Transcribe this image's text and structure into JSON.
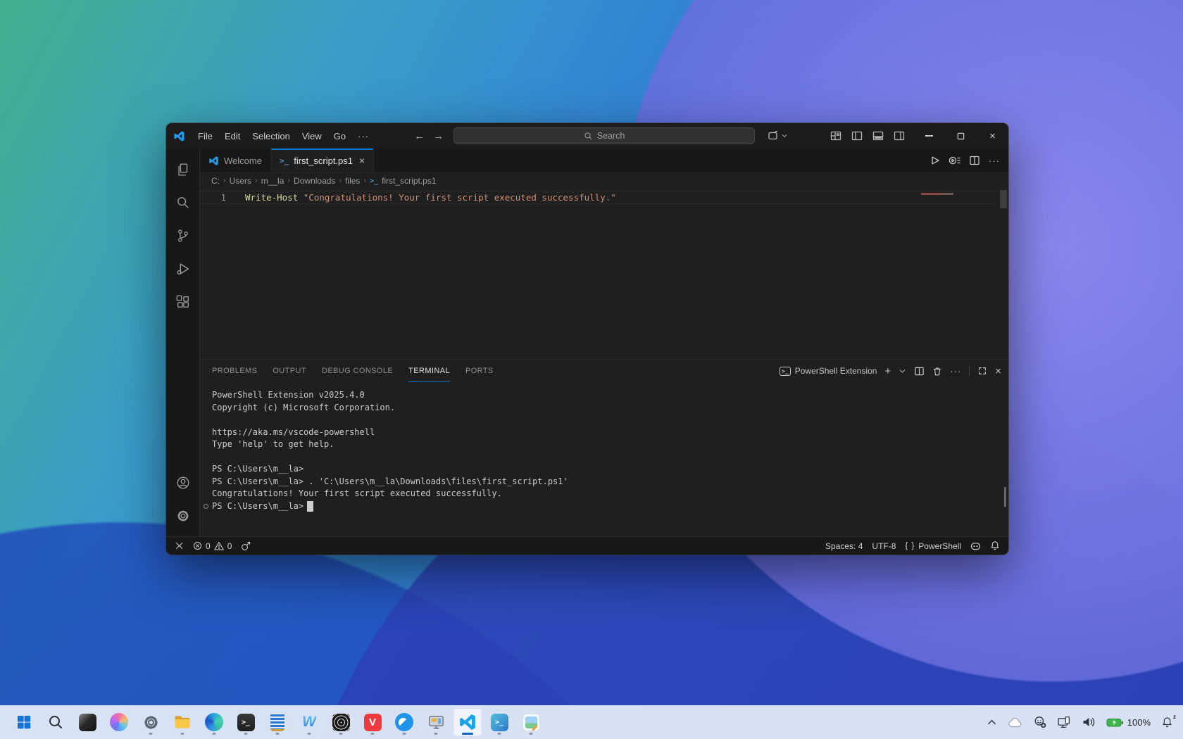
{
  "titlebar": {
    "menus": [
      "File",
      "Edit",
      "Selection",
      "View",
      "Go"
    ],
    "search_placeholder": "Search"
  },
  "glyphs": {
    "back": "←",
    "forward": "→",
    "ellipsis": "···",
    "close": "×",
    "plus": "+",
    "ps": ">_",
    "braces": "{ }"
  },
  "tabs": {
    "welcome": "Welcome",
    "script": "first_script.ps1"
  },
  "breadcrumb": {
    "items": [
      "C:",
      "Users",
      "m__la",
      "Downloads",
      "files"
    ],
    "separator": "›",
    "file": "first_script.ps1"
  },
  "editor": {
    "line_number": "1",
    "cmdlet": "Write-Host",
    "string": "\"Congratulations! Your first script executed successfully.\""
  },
  "panel": {
    "tabs": [
      "PROBLEMS",
      "OUTPUT",
      "DEBUG CONSOLE",
      "TERMINAL",
      "PORTS"
    ],
    "active_tab": "TERMINAL",
    "shell_label": "PowerShell Extension"
  },
  "terminal": {
    "lines": [
      "PowerShell Extension v2025.4.0",
      "Copyright (c) Microsoft Corporation.",
      "",
      "https://aka.ms/vscode-powershell",
      "Type 'help' to get help.",
      "",
      "PS C:\\Users\\m__la>",
      "PS C:\\Users\\m__la> . 'C:\\Users\\m__la\\Downloads\\files\\first_script.ps1'",
      "Congratulations! Your first script executed successfully."
    ],
    "prompt": "PS C:\\Users\\m__la>"
  },
  "statusbar": {
    "errors": "0",
    "warnings": "0",
    "spaces": "Spaces: 4",
    "encoding": "UTF-8",
    "language": "PowerShell"
  },
  "taskbar": {
    "apps": [
      "start",
      "search",
      "dark-app",
      "copilot",
      "settings",
      "file-explorer",
      "edge",
      "windows-terminal",
      "striped-app",
      "w-app",
      "rings-app",
      "vivaldi",
      "blue-browser",
      "pc-tools",
      "vscode",
      "powershell",
      "photos"
    ]
  },
  "tray": {
    "battery": "100%"
  },
  "colors": {
    "accent": "#0078d4",
    "cmdlet": "#dcdcaa",
    "string": "#ce9178",
    "terminal_text": "#cccccc",
    "editor_bg": "#1f1f1f",
    "chrome_bg": "#181818"
  }
}
